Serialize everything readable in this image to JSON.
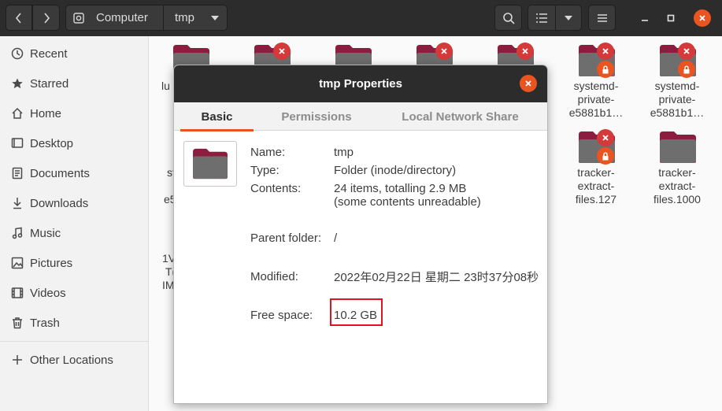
{
  "header": {
    "path": [
      "Computer",
      "tmp"
    ],
    "icons": [
      "back-icon",
      "forward-icon",
      "disk-icon",
      "dropdown-icon",
      "search-icon",
      "list-view-icon",
      "view-options-icon",
      "menu-icon",
      "minimize-icon",
      "maximize-icon",
      "close-icon"
    ]
  },
  "sidebar": {
    "items": [
      {
        "label": "Recent",
        "icon": "clock-icon"
      },
      {
        "label": "Starred",
        "icon": "star-icon"
      },
      {
        "label": "Home",
        "icon": "home-icon"
      },
      {
        "label": "Desktop",
        "icon": "desktop-icon"
      },
      {
        "label": "Documents",
        "icon": "document-icon"
      },
      {
        "label": "Downloads",
        "icon": "download-icon"
      },
      {
        "label": "Music",
        "icon": "music-icon"
      },
      {
        "label": "Pictures",
        "icon": "pictures-icon"
      },
      {
        "label": "Videos",
        "icon": "videos-icon"
      },
      {
        "label": "Trash",
        "icon": "trash-icon"
      }
    ],
    "other": {
      "label": "Other Locations",
      "icon": "plus-icon"
    }
  },
  "files": {
    "partial_labels": [
      "lu",
      "st",
      "e5",
      "1V",
      "T(",
      "IM"
    ],
    "items": [
      {
        "lines": [
          "systemd-",
          "private-",
          "e5881b1…"
        ],
        "badge": "lock"
      },
      {
        "lines": [
          "systemd-",
          "private-",
          "e5881b1…"
        ],
        "badge": "lock"
      },
      {
        "lines": [
          "tracker-",
          "extract-",
          "files.127"
        ],
        "badge": "lock"
      },
      {
        "lines": [
          "tracker-",
          "extract-",
          "files.1000"
        ],
        "badge": "none"
      }
    ]
  },
  "dialog": {
    "title": "tmp Properties",
    "tabs": [
      "Basic",
      "Permissions",
      "Local Network Share"
    ],
    "active_tab": "Basic",
    "props": {
      "name_label": "Name:",
      "name_value": "tmp",
      "type_label": "Type:",
      "type_value": "Folder (inode/directory)",
      "contents_label": "Contents:",
      "contents_value_1": "24 items, totalling 2.9 MB",
      "contents_value_2": "(some contents unreadable)",
      "parent_label": "Parent folder:",
      "parent_value": "/",
      "modified_label": "Modified:",
      "modified_value": "2022年02月22日 星期二 23时37分08秒",
      "free_label": "Free space:",
      "free_value": "10.2 GB"
    }
  },
  "colors": {
    "accent": "#e95420",
    "folder": "#6e6e6e",
    "folder_tab": "#8b1e3f",
    "highlight": "#e0141e"
  }
}
